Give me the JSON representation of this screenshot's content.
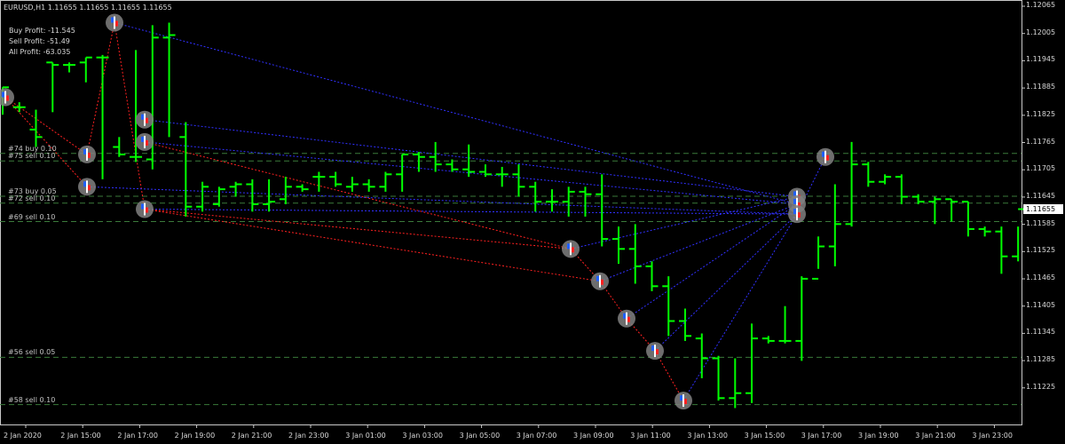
{
  "header": {
    "symbol_info": "EURUSD,H1  1.11655 1.11655 1.11655 1.11655",
    "buy_profit": "Buy Profit: -11.545",
    "sell_profit": "Sell Profit: -51.49",
    "all_profit": "All Profit: -63.035"
  },
  "order_labels": [
    {
      "text": "#74 buy 0.10",
      "price": 1.11767
    },
    {
      "text": "#75 sell 0.10",
      "price": 1.11752
    },
    {
      "text": "#73 buy 0.05",
      "price": 1.11681
    },
    {
      "text": "#72 sell 0.10",
      "price": 1.11667
    },
    {
      "text": "#69 sell 0.10",
      "price": 1.1163
    },
    {
      "text": "#56 sell 0.05",
      "price": 1.11357
    },
    {
      "text": "#58 sell 0.10",
      "price": 1.11262
    }
  ],
  "chart_data": {
    "type": "ohlc",
    "symbol": "EURUSD",
    "timeframe": "H1",
    "current_price": "1.11655",
    "y_ticks": [
      "1.12065",
      "1.12005",
      "1.11945",
      "1.11885",
      "1.11825",
      "1.11765",
      "1.11705",
      "1.11645",
      "1.11585",
      "1.11525",
      "1.11465",
      "1.11405",
      "1.11345",
      "1.11285",
      "1.11225"
    ],
    "x_ticks": [
      "2 Jan 2020",
      "2 Jan 15:00",
      "2 Jan 17:00",
      "2 Jan 19:00",
      "2 Jan 21:00",
      "2 Jan 23:00",
      "3 Jan 01:00",
      "3 Jan 03:00",
      "3 Jan 05:00",
      "3 Jan 07:00",
      "3 Jan 09:00",
      "3 Jan 11:00",
      "3 Jan 13:00",
      "3 Jan 15:00",
      "3 Jan 17:00",
      "3 Jan 19:00",
      "3 Jan 21:00",
      "3 Jan 23:00"
    ],
    "ylim": [
      1.11222,
      1.12072
    ],
    "bar_color": "#00ff00",
    "bars": [
      {
        "o": 1.1188,
        "h": 1.119,
        "l": 1.11845,
        "c": 1.119
      },
      {
        "o": 1.1186,
        "h": 1.1187,
        "l": 1.1185,
        "c": 1.1186
      },
      {
        "o": 1.11815,
        "h": 1.11855,
        "l": 1.1178,
        "c": 1.118
      },
      {
        "o": 1.1195,
        "h": 1.1195,
        "l": 1.1185,
        "c": 1.11945
      },
      {
        "o": 1.11945,
        "h": 1.1195,
        "l": 1.1193,
        "c": 1.11945
      },
      {
        "o": 1.1195,
        "h": 1.1196,
        "l": 1.1191,
        "c": 1.1196
      },
      {
        "o": 1.1196,
        "h": 1.11965,
        "l": 1.11715,
        "c": 1.1196
      },
      {
        "o": 1.1178,
        "h": 1.118,
        "l": 1.1176,
        "c": 1.11765
      },
      {
        "o": 1.1176,
        "h": 1.11975,
        "l": 1.1175,
        "c": 1.1176
      },
      {
        "o": 1.11755,
        "h": 1.12025,
        "l": 1.11735,
        "c": 1.12
      },
      {
        "o": 1.12,
        "h": 1.1203,
        "l": 1.118,
        "c": 1.12005
      },
      {
        "o": 1.118,
        "h": 1.1183,
        "l": 1.1164,
        "c": 1.1166
      },
      {
        "o": 1.1166,
        "h": 1.1171,
        "l": 1.1165,
        "c": 1.117
      },
      {
        "o": 1.11665,
        "h": 1.117,
        "l": 1.1166,
        "c": 1.11695
      },
      {
        "o": 1.117,
        "h": 1.1171,
        "l": 1.1168,
        "c": 1.11705
      },
      {
        "o": 1.11705,
        "h": 1.11715,
        "l": 1.1165,
        "c": 1.11665
      },
      {
        "o": 1.11665,
        "h": 1.11715,
        "l": 1.1165,
        "c": 1.1167
      },
      {
        "o": 1.11675,
        "h": 1.1172,
        "l": 1.11665,
        "c": 1.117
      },
      {
        "o": 1.117,
        "h": 1.11705,
        "l": 1.1169,
        "c": 1.11695
      },
      {
        "o": 1.1172,
        "h": 1.1173,
        "l": 1.1169,
        "c": 1.1172
      },
      {
        "o": 1.1172,
        "h": 1.1173,
        "l": 1.117,
        "c": 1.11705
      },
      {
        "o": 1.117,
        "h": 1.1172,
        "l": 1.1169,
        "c": 1.11705
      },
      {
        "o": 1.11705,
        "h": 1.11715,
        "l": 1.1169,
        "c": 1.117
      },
      {
        "o": 1.117,
        "h": 1.1173,
        "l": 1.1169,
        "c": 1.11725
      },
      {
        "o": 1.11725,
        "h": 1.11765,
        "l": 1.1169,
        "c": 1.11765
      },
      {
        "o": 1.11765,
        "h": 1.1177,
        "l": 1.1173,
        "c": 1.1176
      },
      {
        "o": 1.1176,
        "h": 1.1179,
        "l": 1.1173,
        "c": 1.11745
      },
      {
        "o": 1.11745,
        "h": 1.11755,
        "l": 1.1173,
        "c": 1.11735
      },
      {
        "o": 1.11735,
        "h": 1.11785,
        "l": 1.1172,
        "c": 1.1173
      },
      {
        "o": 1.1173,
        "h": 1.11745,
        "l": 1.1172,
        "c": 1.11725
      },
      {
        "o": 1.11725,
        "h": 1.1174,
        "l": 1.117,
        "c": 1.11725
      },
      {
        "o": 1.11725,
        "h": 1.11745,
        "l": 1.1168,
        "c": 1.117
      },
      {
        "o": 1.117,
        "h": 1.1171,
        "l": 1.1165,
        "c": 1.1167
      },
      {
        "o": 1.1167,
        "h": 1.11695,
        "l": 1.1165,
        "c": 1.1167
      },
      {
        "o": 1.1167,
        "h": 1.117,
        "l": 1.1164,
        "c": 1.1169
      },
      {
        "o": 1.1169,
        "h": 1.117,
        "l": 1.1164,
        "c": 1.11685
      },
      {
        "o": 1.11685,
        "h": 1.11725,
        "l": 1.1158,
        "c": 1.11595
      },
      {
        "o": 1.11595,
        "h": 1.1162,
        "l": 1.11545,
        "c": 1.11575
      },
      {
        "o": 1.11575,
        "h": 1.11625,
        "l": 1.11505,
        "c": 1.1154
      },
      {
        "o": 1.1154,
        "h": 1.1155,
        "l": 1.1149,
        "c": 1.115
      },
      {
        "o": 1.115,
        "h": 1.1152,
        "l": 1.114,
        "c": 1.1143
      },
      {
        "o": 1.1143,
        "h": 1.11455,
        "l": 1.1139,
        "c": 1.114
      },
      {
        "o": 1.11395,
        "h": 1.11405,
        "l": 1.11315,
        "c": 1.11355
      },
      {
        "o": 1.11355,
        "h": 1.1136,
        "l": 1.1127,
        "c": 1.11275
      },
      {
        "o": 1.11275,
        "h": 1.11355,
        "l": 1.11255,
        "c": 1.11285
      },
      {
        "o": 1.11285,
        "h": 1.11425,
        "l": 1.11265,
        "c": 1.11395
      },
      {
        "o": 1.11395,
        "h": 1.114,
        "l": 1.11385,
        "c": 1.1139
      },
      {
        "o": 1.1139,
        "h": 1.1146,
        "l": 1.11385,
        "c": 1.1139
      },
      {
        "o": 1.1139,
        "h": 1.1152,
        "l": 1.1135,
        "c": 1.11515
      },
      {
        "o": 1.11515,
        "h": 1.116,
        "l": 1.11535,
        "c": 1.1158
      },
      {
        "o": 1.1158,
        "h": 1.11705,
        "l": 1.1154,
        "c": 1.11625
      },
      {
        "o": 1.11625,
        "h": 1.1179,
        "l": 1.1162,
        "c": 1.11745
      },
      {
        "o": 1.11745,
        "h": 1.1175,
        "l": 1.117,
        "c": 1.1171
      },
      {
        "o": 1.1171,
        "h": 1.11725,
        "l": 1.11705,
        "c": 1.1172
      },
      {
        "o": 1.1172,
        "h": 1.11725,
        "l": 1.11665,
        "c": 1.1168
      },
      {
        "o": 1.1168,
        "h": 1.11685,
        "l": 1.11665,
        "c": 1.1167
      },
      {
        "o": 1.1167,
        "h": 1.1168,
        "l": 1.11625,
        "c": 1.11675
      },
      {
        "o": 1.11675,
        "h": 1.11675,
        "l": 1.1163,
        "c": 1.1167
      },
      {
        "o": 1.1167,
        "h": 1.1167,
        "l": 1.116,
        "c": 1.11615
      },
      {
        "o": 1.11615,
        "h": 1.1162,
        "l": 1.116,
        "c": 1.1161
      },
      {
        "o": 1.1161,
        "h": 1.1162,
        "l": 1.11525,
        "c": 1.1156
      },
      {
        "o": 1.1156,
        "h": 1.1162,
        "l": 1.1155,
        "c": 1.11655
      }
    ],
    "order_lines": [
      1.11767,
      1.11752,
      1.11681,
      1.11667,
      1.1163,
      1.11357,
      1.11262
    ],
    "order_markers": [
      {
        "bar": 0,
        "price": 1.1188
      },
      {
        "bar": 3,
        "price": 1.11765
      },
      {
        "bar": 3,
        "price": 1.117
      },
      {
        "bar": 4,
        "price": 1.1203
      },
      {
        "bar": 5,
        "price": 1.11835
      },
      {
        "bar": 5,
        "price": 1.1179
      },
      {
        "bar": 5,
        "price": 1.11655
      },
      {
        "bar": 20,
        "price": 1.11575
      },
      {
        "bar": 21,
        "price": 1.1151
      },
      {
        "bar": 22,
        "price": 1.11435
      },
      {
        "bar": 23,
        "price": 1.1137
      },
      {
        "bar": 24,
        "price": 1.1127
      },
      {
        "bar": 28,
        "price": 1.1168
      },
      {
        "bar": 28,
        "price": 1.11665
      },
      {
        "bar": 28,
        "price": 1.11645
      },
      {
        "bar": 29,
        "price": 1.1176
      }
    ],
    "trade_lines": [
      {
        "from": [
          0,
          1.1188
        ],
        "to": [
          3,
          1.11765
        ],
        "color": "#ff2020"
      },
      {
        "from": [
          0,
          1.1188
        ],
        "to": [
          3,
          1.117
        ],
        "color": "#ff2020"
      },
      {
        "from": [
          3,
          1.11765
        ],
        "to": [
          4,
          1.1203
        ],
        "color": "#ff2020"
      },
      {
        "from": [
          4,
          1.1203
        ],
        "to": [
          5,
          1.11655
        ],
        "color": "#ff2020"
      },
      {
        "from": [
          4,
          1.1203
        ],
        "to": [
          28,
          1.11665
        ],
        "color": "#3030ff"
      },
      {
        "from": [
          5,
          1.11835
        ],
        "to": [
          28,
          1.1168
        ],
        "color": "#3030ff"
      },
      {
        "from": [
          5,
          1.1179
        ],
        "to": [
          20,
          1.11575
        ],
        "color": "#ff2020"
      },
      {
        "from": [
          5,
          1.1179
        ],
        "to": [
          28,
          1.11665
        ],
        "color": "#3030ff"
      },
      {
        "from": [
          5,
          1.11655
        ],
        "to": [
          20,
          1.11575
        ],
        "color": "#ff2020"
      },
      {
        "from": [
          5,
          1.11655
        ],
        "to": [
          21,
          1.1151
        ],
        "color": "#ff2020"
      },
      {
        "from": [
          5,
          1.11655
        ],
        "to": [
          28,
          1.11645
        ],
        "color": "#3030ff"
      },
      {
        "from": [
          3,
          1.117
        ],
        "to": [
          28,
          1.11645
        ],
        "color": "#3030ff"
      },
      {
        "from": [
          20,
          1.11575
        ],
        "to": [
          21,
          1.1151
        ],
        "color": "#ff2020"
      },
      {
        "from": [
          21,
          1.1151
        ],
        "to": [
          22,
          1.11435
        ],
        "color": "#ff2020"
      },
      {
        "from": [
          22,
          1.11435
        ],
        "to": [
          23,
          1.1137
        ],
        "color": "#ff2020"
      },
      {
        "from": [
          23,
          1.1137
        ],
        "to": [
          24,
          1.1127
        ],
        "color": "#ff2020"
      },
      {
        "from": [
          20,
          1.11575
        ],
        "to": [
          28,
          1.1168
        ],
        "color": "#3030ff"
      },
      {
        "from": [
          21,
          1.1151
        ],
        "to": [
          28,
          1.11665
        ],
        "color": "#3030ff"
      },
      {
        "from": [
          22,
          1.11435
        ],
        "to": [
          28,
          1.11665
        ],
        "color": "#3030ff"
      },
      {
        "from": [
          23,
          1.1137
        ],
        "to": [
          28,
          1.11645
        ],
        "color": "#3030ff"
      },
      {
        "from": [
          24,
          1.1127
        ],
        "to": [
          28,
          1.11645
        ],
        "color": "#3030ff"
      },
      {
        "from": [
          28,
          1.11645
        ],
        "to": [
          29,
          1.1176
        ],
        "color": "#3030ff"
      }
    ]
  }
}
